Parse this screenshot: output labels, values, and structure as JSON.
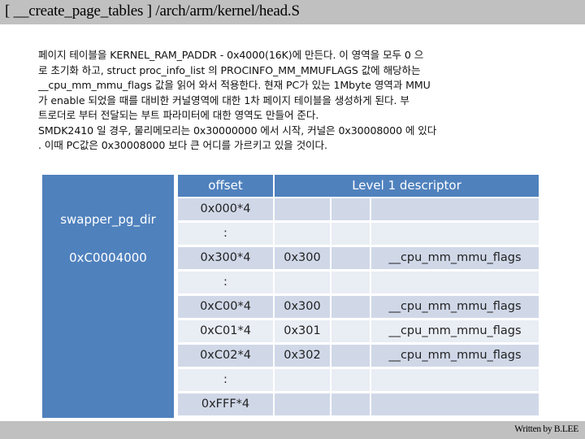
{
  "header": {
    "title": "[ __create_page_tables ] /arch/arm/kernel/head.S"
  },
  "description": {
    "lines": [
      "페이지 테이블을 KERNEL_RAM_PADDR - 0x4000(16K)에 만든다. 이 영역을 모두 0 으",
      "로 초기화 하고, struct proc_info_list 의 PROCINFO_MM_MMUFLAGS 값에 해당하는",
      "__cpu_mm_mmu_flags  값을 읽어 와서 적용한다. 현재 PC가 있는 1Mbyte 영역과 MMU",
      "가 enable 되었을 때를 대비한 커널영역에 대한 1차 페이지 테이블을 생성하게 된다. 부",
      "트로더로 부터 전달되는 부트 파라미터에 대한 영역도 만들어 준다.",
      "SMDK2410 일 경우, 물리메모리는 0x30000000 에서 시작, 커널은 0x30008000 에 있다",
      ". 이때 PC값은 0x30008000 보다 큰 어디를 가르키고 있을 것이다."
    ]
  },
  "table": {
    "left_label": "swapper_pg_dir",
    "left_address": "0xC0004000",
    "headers": {
      "offset": "offset",
      "descriptor": "Level 1 descriptor"
    },
    "rows": [
      {
        "offset": "0x000*4",
        "base": "",
        "gap": "",
        "flags": ""
      },
      {
        "offset": ":",
        "base": "",
        "gap": "",
        "flags": ""
      },
      {
        "offset": "0x300*4",
        "base": "0x300",
        "gap": "",
        "flags": "__cpu_mm_mmu_flags"
      },
      {
        "offset": ":",
        "base": "",
        "gap": "",
        "flags": ""
      },
      {
        "offset": "0xC00*4",
        "base": "0x300",
        "gap": "",
        "flags": "__cpu_mm_mmu_flags"
      },
      {
        "offset": "0xC01*4",
        "base": "0x301",
        "gap": "",
        "flags": "__cpu_mm_mmu_flags"
      },
      {
        "offset": "0xC02*4",
        "base": "0x302",
        "gap": "",
        "flags": "__cpu_mm_mmu_flags"
      },
      {
        "offset": ":",
        "base": "",
        "gap": "",
        "flags": ""
      },
      {
        "offset": "0xFFF*4",
        "base": "",
        "gap": "",
        "flags": ""
      }
    ]
  },
  "footer": {
    "author": "Written by B.LEE"
  },
  "colors": {
    "header_blue": "#4f81bd",
    "row_dark": "#d0d8e8",
    "row_light": "#e9edf4",
    "bar_gray": "#c0c0c0"
  }
}
